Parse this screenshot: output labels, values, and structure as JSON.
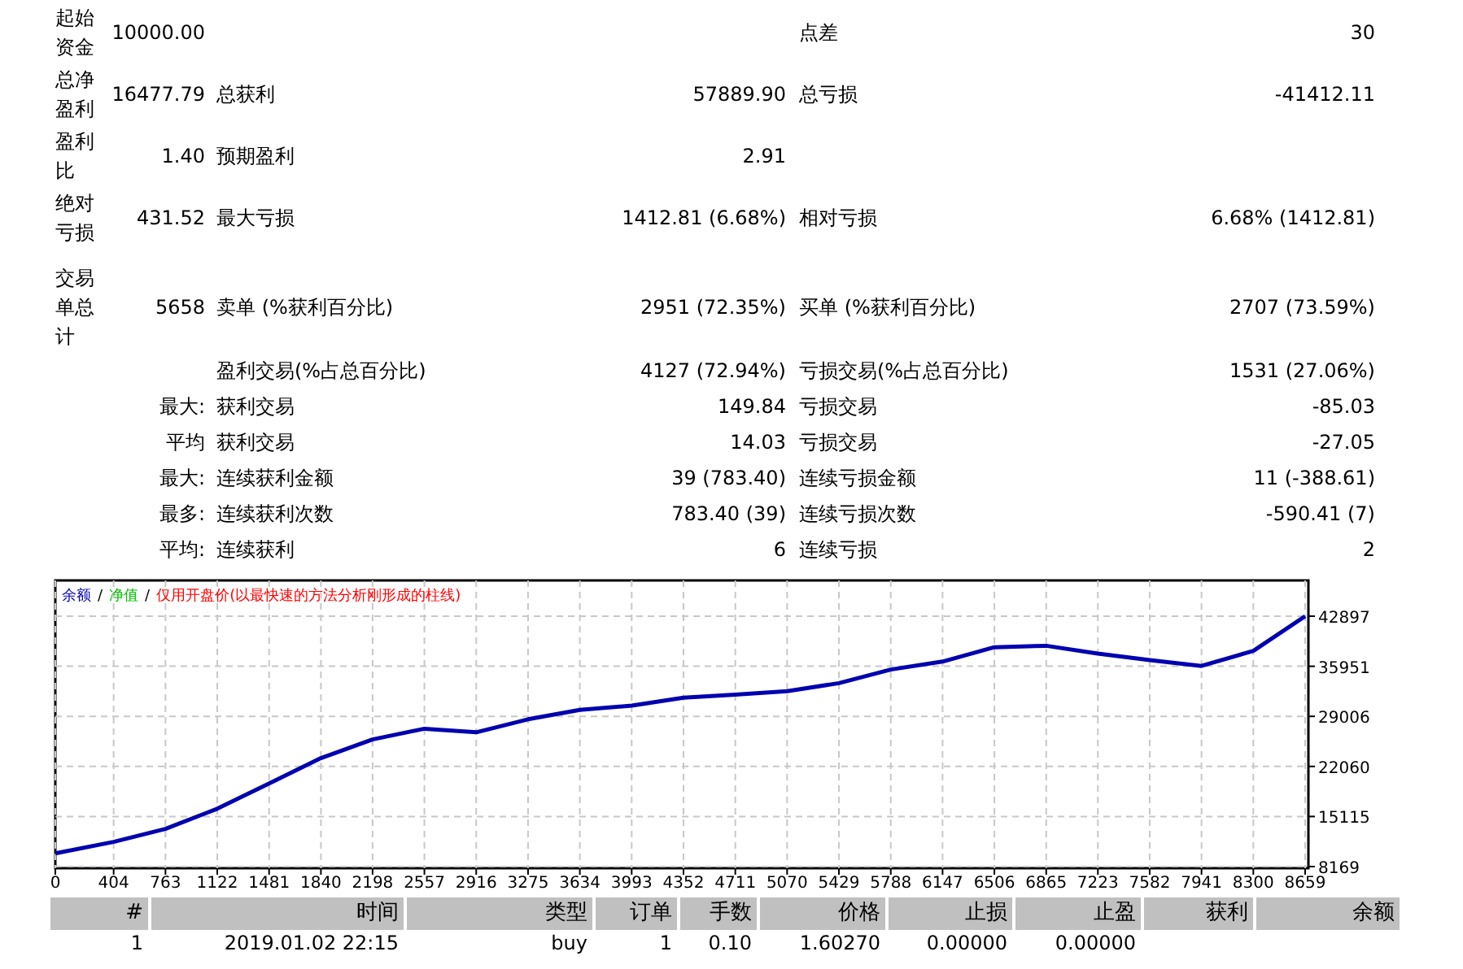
{
  "stats": [
    {
      "label": "起始资金",
      "value": "10000.00",
      "label3": "点差",
      "value3": "30"
    },
    {
      "label": "总净盈利",
      "value": "16477.79",
      "label2": "总获利",
      "value2": "57889.90",
      "label3": "总亏损",
      "value3": "-41412.11"
    },
    {
      "label": "盈利比",
      "value": "1.40",
      "label2": "预期盈利",
      "value2": "2.91"
    },
    {
      "label": "绝对亏损",
      "value": "431.52",
      "label2": "最大亏损",
      "value2": "1412.81 (6.68%)",
      "label3": "相对亏损",
      "value3": "6.68% (1412.81)"
    },
    {
      "label": "交易单总计",
      "value": "5658",
      "label2": "卖单 (%获利百分比)",
      "value2": "2951 (72.35%)",
      "label3": "买单 (%获利百分比)",
      "value3": "2707 (73.59%)"
    },
    {
      "label2": "盈利交易(%占总百分比)",
      "value2": "4127 (72.94%)",
      "label3": "亏损交易(%占总百分比)",
      "value3": "1531 (27.06%)"
    },
    {
      "value": "最大:",
      "label2": "获利交易",
      "value2": "149.84",
      "label3": "亏损交易",
      "value3": "-85.03"
    },
    {
      "value": "平均",
      "label2": "获利交易",
      "value2": "14.03",
      "label3": "亏损交易",
      "value3": "-27.05"
    },
    {
      "value": "最大:",
      "label2": "连续获利金额",
      "value2": "39 (783.40)",
      "label3": "连续亏损金额",
      "value3": "11 (-388.61)"
    },
    {
      "value": "最多:",
      "label2": "连续获利次数",
      "value2": "783.40 (39)",
      "label3": "连续亏损次数",
      "value3": "-590.41 (7)"
    },
    {
      "value": "平均:",
      "label2": "连续获利",
      "value2": "6",
      "label3": "连续亏损",
      "value3": "2"
    }
  ],
  "chart": {
    "separator": "/",
    "legend": [
      {
        "text": "净值",
        "color": "#00c000"
      },
      {
        "text": "仅用开盘价(以最快速的方法分析刚形成的柱线)",
        "color": "#ff0000"
      }
    ],
    "chart_data": {
      "type": "line",
      "grid": true,
      "x": [
        0,
        404,
        763,
        1122,
        1481,
        1840,
        2198,
        2557,
        2916,
        3275,
        3634,
        3993,
        4352,
        4711,
        5070,
        5429,
        5788,
        6147,
        6506,
        6865,
        7223,
        7582,
        7941,
        8300,
        8659
      ],
      "series": [
        {
          "name": "余额",
          "color": "#0000b0",
          "values": [
            10000,
            11600,
            13400,
            16200,
            19700,
            23200,
            25800,
            27300,
            26800,
            28600,
            29900,
            30500,
            31600,
            32000,
            32500,
            33600,
            35500,
            36600,
            38600,
            38800,
            37700,
            36800,
            36000,
            38100,
            42897
          ]
        }
      ],
      "xticks": [
        0,
        404,
        763,
        1122,
        1481,
        1840,
        2198,
        2557,
        2916,
        3275,
        3634,
        3993,
        4352,
        4711,
        5070,
        5429,
        5788,
        6147,
        6506,
        6865,
        7223,
        7582,
        7941,
        8300,
        8659
      ],
      "yticks": [
        8169,
        15115,
        22060,
        29006,
        35951,
        42897
      ],
      "xlim": [
        0,
        8659
      ],
      "ylim": [
        8169,
        42897
      ]
    }
  },
  "table": {
    "columns": [
      "#",
      "时间",
      "类型",
      "订单",
      "手数",
      "价格",
      "止损",
      "止盈",
      "获利",
      "余额"
    ],
    "rows": [
      [
        "1",
        "2019.01.02 22:15",
        "buy",
        "1",
        "0.10",
        "1.60270",
        "0.00000",
        "0.00000"
      ]
    ]
  }
}
